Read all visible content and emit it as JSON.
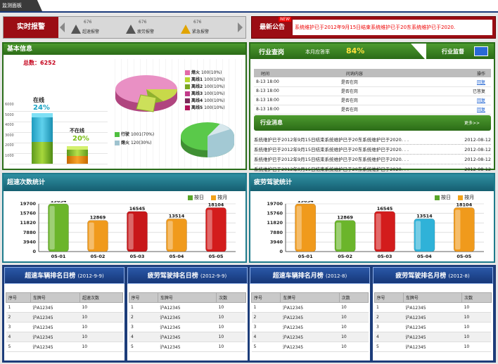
{
  "header": {
    "tab": "监测面板"
  },
  "alarm": {
    "label": "实时报警",
    "items": [
      {
        "count": "676",
        "name": "超速报警",
        "icon": "warning-triangle"
      },
      {
        "count": "676",
        "name": "疲劳报警",
        "icon": "warning-triangle"
      },
      {
        "count": "676",
        "name": "紧急报警",
        "icon": "warning-triangle"
      }
    ]
  },
  "notice": {
    "label": "最新公告",
    "badge": "NEW",
    "text": "系统维护已于2012年9月15日结束系统维护已于20东系统维护已于2020."
  },
  "basic": {
    "title": "基本信息",
    "total": "总数：6252",
    "online_label": "在线",
    "online_pct": "24%",
    "offline_label": "不在线",
    "offline_pct": "20%",
    "yticks": [
      "6000",
      "5000",
      "4000",
      "3000",
      "2000",
      "1000"
    ],
    "pie1_legend": [
      {
        "name": "熄火",
        "val": "100(10%)",
        "color": "#e36aa8"
      },
      {
        "name": "离线1",
        "val": "100(10%)",
        "color": "#b8d630"
      },
      {
        "name": "离线2",
        "val": "100(10%)",
        "color": "#7aa621"
      },
      {
        "name": "离线3",
        "val": "100(10%)",
        "color": "#c23a8a"
      },
      {
        "name": "离线4",
        "val": "100(10%)",
        "color": "#7c2a5a"
      },
      {
        "name": "离线5",
        "val": "100(10%)",
        "color": "#b2125a"
      }
    ],
    "pie2_legend": [
      {
        "name": "行驶",
        "val": "1001(70%)",
        "color": "#4fbf3f"
      },
      {
        "name": "熄火",
        "val": "120(30%)",
        "color": "#9fc3cf"
      }
    ]
  },
  "industry": {
    "title": "行业查岗",
    "rate_label": "本月应答率",
    "rate": "84%",
    "supervise": "行业监督",
    "columns": [
      "时间",
      "问询内容",
      "操作"
    ],
    "rows": [
      {
        "time": "8-13 18:00",
        "content": "是否在岗",
        "op": "回复"
      },
      {
        "time": "8-13 18:00",
        "content": "是否在岗",
        "op": "已答复"
      },
      {
        "time": "8-13 18:00",
        "content": "是否在岗",
        "op": "回复"
      },
      {
        "time": "8-13 18:00",
        "content": "是否在岗",
        "op": "回复"
      }
    ],
    "news_title": "行业消息",
    "more": "更多>>",
    "news": [
      {
        "text": "系统维护已于2012年9月15日结束系统维护已于20东系统维护已于2020. . .",
        "date": "2012-08-12"
      },
      {
        "text": "系统维护已于2012年9月15日结束系统维护已于20东系统维护已于2020. . .",
        "date": "2012-08-12"
      },
      {
        "text": "系统维护已于2012年9月15日结束系统维护已于20东系统维护已于2020. . .",
        "date": "2012-08-12"
      },
      {
        "text": "系统维护已于2012年9月15日结束系统维护已于20东系统维护已于2020. . .",
        "date": "2012-08-12"
      }
    ]
  },
  "charts": {
    "legend_day": "按日",
    "legend_month": "按月",
    "legend_day_color": "#5aa62a",
    "legend_month_color": "#f2a21a"
  },
  "chart_data": [
    {
      "type": "bar",
      "title": "超速次数统计",
      "categories": [
        "05-01",
        "05-02",
        "05-03",
        "05-04",
        "05-05"
      ],
      "values": [
        19654,
        12869,
        16545,
        13514,
        18104
      ],
      "colors": [
        "#6bb52b",
        "#f09a1c",
        "#c8171a",
        "#f09a1c",
        "#d31c1c"
      ],
      "ylim": [
        0,
        19700
      ],
      "yticks": [
        0,
        3940,
        7880,
        11820,
        15760,
        19700
      ]
    },
    {
      "type": "bar",
      "title": "疲劳驾驶统计",
      "categories": [
        "05-01",
        "05-02",
        "05-03",
        "05-04",
        "05-05"
      ],
      "values": [
        19654,
        12869,
        16545,
        13514,
        18104
      ],
      "colors": [
        "#f09a1c",
        "#6bb52b",
        "#d31c1c",
        "#2fb2d8",
        "#f09a1c"
      ],
      "ylim": [
        0,
        19700
      ],
      "yticks": [
        0,
        3940,
        7880,
        11820,
        15760,
        19700
      ]
    }
  ],
  "rankings": [
    {
      "title": "超速车辆排名日榜",
      "date": "(2012-9-9)",
      "columns": [
        "序号",
        "车牌号",
        "超速次数"
      ],
      "rows": [
        [
          "1",
          "沪A12345",
          "10"
        ],
        [
          "2",
          "沪A12345",
          "10"
        ],
        [
          "3",
          "沪A12345",
          "10"
        ],
        [
          "4",
          "沪A12345",
          "10"
        ],
        [
          "5",
          "沪A12345",
          "10"
        ]
      ]
    },
    {
      "title": "疲劳驾驶排名日榜",
      "date": "(2012-9-9)",
      "columns": [
        "序号",
        "车牌号",
        "次数"
      ],
      "rows": [
        [
          "1",
          "沪A12345",
          "10"
        ],
        [
          "2",
          "沪A12345",
          "10"
        ],
        [
          "3",
          "沪A12345",
          "10"
        ],
        [
          "4",
          "沪A12345",
          "10"
        ],
        [
          "5",
          "沪A12345",
          "10"
        ]
      ]
    },
    {
      "title": "超速车辆排名月榜",
      "date": "(2012-8)",
      "columns": [
        "序号",
        "车牌号",
        "次数"
      ],
      "rows": [
        [
          "1",
          "沪A12345",
          "10"
        ],
        [
          "2",
          "沪A12345",
          "10"
        ],
        [
          "3",
          "沪A12345",
          "10"
        ],
        [
          "4",
          "沪A12345",
          "10"
        ],
        [
          "5",
          "沪A12345",
          "10"
        ]
      ]
    },
    {
      "title": "疲劳驾驶排名月榜",
      "date": "(2012-8)",
      "columns": [
        "序号",
        "车牌号",
        "次数"
      ],
      "rows": [
        [
          "1",
          "沪A12345",
          "10"
        ],
        [
          "2",
          "沪A12345",
          "10"
        ],
        [
          "3",
          "沪A12345",
          "10"
        ],
        [
          "4",
          "沪A12345",
          "10"
        ],
        [
          "5",
          "沪A12345",
          "10"
        ]
      ]
    }
  ]
}
